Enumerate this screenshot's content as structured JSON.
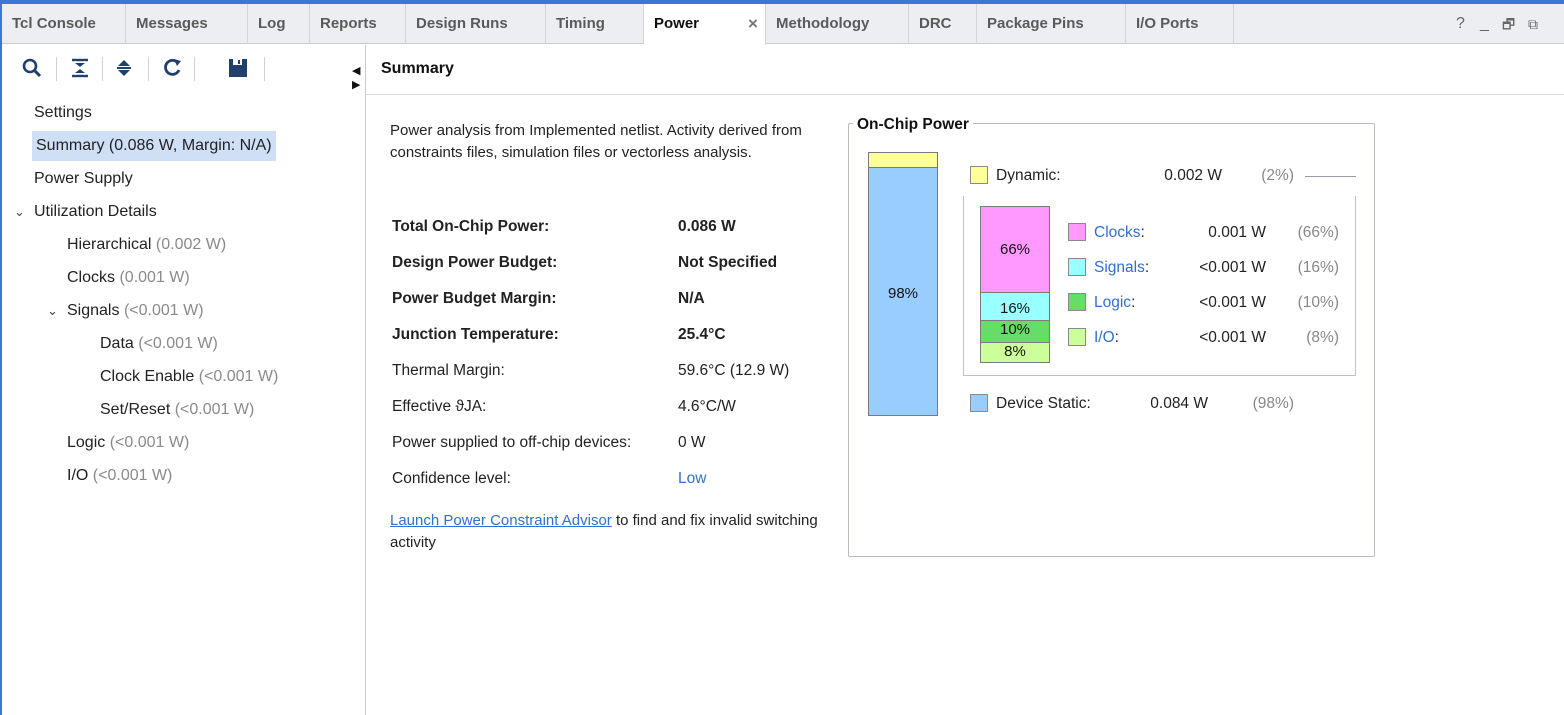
{
  "tabs": [
    {
      "label": "Tcl Console"
    },
    {
      "label": "Messages"
    },
    {
      "label": "Log"
    },
    {
      "label": "Reports"
    },
    {
      "label": "Design Runs"
    },
    {
      "label": "Timing"
    },
    {
      "label": "Power",
      "active": true,
      "close": "×"
    },
    {
      "label": "Methodology"
    },
    {
      "label": "DRC"
    },
    {
      "label": "Package Pins"
    },
    {
      "label": "I/O Ports"
    }
  ],
  "window_controls": {
    "help": "?",
    "minimize": "_",
    "restore": "🗗",
    "float": "⧉"
  },
  "toolbar": {
    "icons": [
      "search-icon",
      "collapse-all-icon",
      "expand-all-icon",
      "refresh-icon",
      "save-icon"
    ]
  },
  "tree": [
    {
      "label": "Settings",
      "muted": ""
    },
    {
      "label": "Summary (0.086 W, Margin: N/A)",
      "muted": "",
      "selected": true
    },
    {
      "label": "Power Supply",
      "muted": ""
    },
    {
      "label": "Utilization Details",
      "muted": "",
      "expanded": true
    },
    {
      "label": "Hierarchical",
      "muted": "(0.002 W)"
    },
    {
      "label": "Clocks",
      "muted": "(0.001 W)"
    },
    {
      "label": "Signals",
      "muted": "(<0.001 W)",
      "expanded": true
    },
    {
      "label": "Data",
      "muted": "(<0.001 W)"
    },
    {
      "label": "Clock Enable",
      "muted": "(<0.001 W)"
    },
    {
      "label": "Set/Reset",
      "muted": "(<0.001 W)"
    },
    {
      "label": "Logic",
      "muted": "(<0.001 W)"
    },
    {
      "label": "I/O",
      "muted": "(<0.001 W)"
    }
  ],
  "summary": {
    "title": "Summary",
    "description": "Power analysis from Implemented netlist. Activity derived from constraints files, simulation files or vectorless analysis.",
    "rows": [
      {
        "label": "Total On-Chip Power:",
        "value": "0.086 W"
      },
      {
        "label": "Design Power Budget:",
        "value": "Not Specified"
      },
      {
        "label": "Power Budget Margin:",
        "value": "N/A"
      },
      {
        "label": "Junction Temperature:",
        "value": "25.4°C"
      },
      {
        "label": "Thermal Margin:",
        "value": "59.6°C (12.9 W)"
      },
      {
        "label": "Effective ϑJA:",
        "value": "4.6°C/W"
      },
      {
        "label": "Power supplied to off-chip devices:",
        "value": "0 W"
      },
      {
        "label": "Confidence level:",
        "value": "Low"
      }
    ],
    "advisor_link": "Launch Power Constraint Advisor",
    "advisor_text": " to find and fix invalid switching activity"
  },
  "on_chip": {
    "title": "On-Chip Power",
    "dynamic": {
      "label": "Dynamic:",
      "value": "0.002 W",
      "pct": "(2%)",
      "color": "#ffff99"
    },
    "static": {
      "label": "Device Static:",
      "value": "0.084 W",
      "pct": "(98%)",
      "color": "#99ccff",
      "bar_label": "98%"
    },
    "breakdown": [
      {
        "label": "Clocks",
        "sep": ":",
        "value": "0.001 W",
        "pct": "(66%)",
        "bar_label": "66%",
        "color": "#ff99ff"
      },
      {
        "label": "Signals",
        "sep": ":",
        "value": "<0.001 W",
        "pct": "(16%)",
        "bar_label": "16%",
        "color": "#99ffff"
      },
      {
        "label": "Logic",
        "sep": ":",
        "value": "<0.001 W",
        "pct": "(10%)",
        "bar_label": "10%",
        "color": "#66dd66"
      },
      {
        "label": "I/O",
        "sep": ":",
        "value": "<0.001 W",
        "pct": "(8%)",
        "bar_label": "8%",
        "color": "#ccff99"
      }
    ]
  }
}
